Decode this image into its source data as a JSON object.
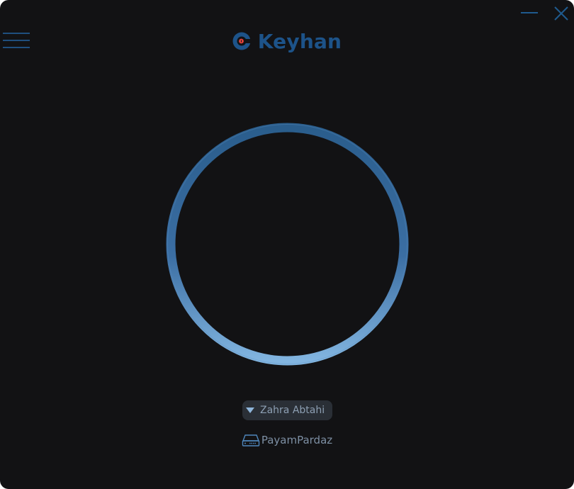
{
  "app": {
    "name": "Keyhan",
    "accent_color": "#1d5389",
    "background_color": "#121214"
  },
  "titlebar": {
    "menu_icon": "hamburger-menu-icon",
    "minimize_icon": "minimize-icon",
    "close_icon": "close-icon"
  },
  "brand": {
    "title": "Keyhan",
    "logo_icon": "keyhan-logo-icon"
  },
  "connection": {
    "button_icon": "connect-ring",
    "ring_color_top": "#2a5d8c",
    "ring_color_bottom": "#82b5e0"
  },
  "account": {
    "user_name": "Zahra Abtahi",
    "dropdown_icon": "caret-down-icon"
  },
  "server": {
    "name": "PayamPardaz",
    "icon": "server-icon"
  }
}
